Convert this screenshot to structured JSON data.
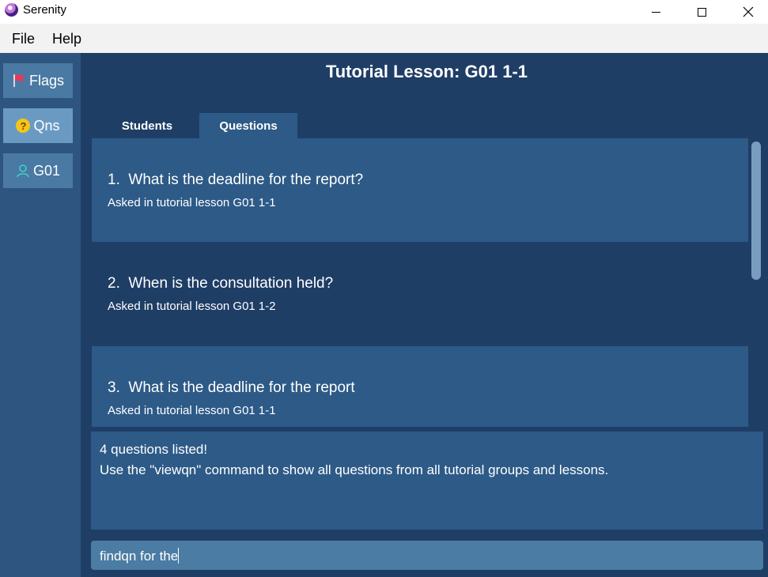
{
  "window": {
    "title": "Serenity"
  },
  "menu": {
    "file": "File",
    "help": "Help"
  },
  "sidebar": {
    "flags_label": "Flags",
    "qns_label": "Qns",
    "qns_icon_glyph": "?",
    "group_label": "G01"
  },
  "header": {
    "title": "Tutorial Lesson: G01 1-1"
  },
  "tabs": [
    {
      "label": "Students",
      "active": false
    },
    {
      "label": "Questions",
      "active": true
    }
  ],
  "questions": [
    {
      "index": "1.",
      "text": "What is the deadline for the report?",
      "subtitle": "Asked in tutorial lesson G01 1-1"
    },
    {
      "index": "2.",
      "text": "When is the consultation held?",
      "subtitle": "Asked in tutorial lesson G01 1-2"
    },
    {
      "index": "3.",
      "text": "What is the deadline for the report",
      "subtitle": "Asked in tutorial lesson G01 1-1"
    }
  ],
  "result": {
    "line1": "4 questions listed!",
    "line2": "Use the \"viewqn\" command to show all questions from all tutorial groups and lessons."
  },
  "command": {
    "value": "findqn for the"
  },
  "colors": {
    "main_bg": "#1f3e66",
    "sidebar_bg": "#2d5580",
    "card_bg": "#2d5a87",
    "button_bg": "#4a79a3",
    "active_button_bg": "#6a9ac2",
    "command_bg": "#4b7ca3"
  }
}
